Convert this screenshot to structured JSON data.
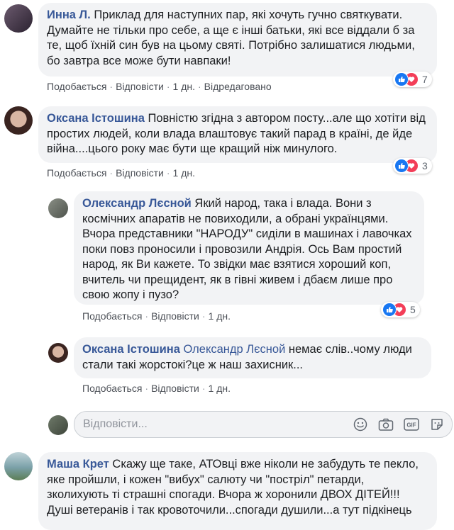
{
  "comments": [
    {
      "author": "Инна Л.",
      "text": "Приклад для наступних пар, які хочуть гучно святкувати. Думайте не тільки про себе, а ще є інші батьки, які все віддали б за те, щоб їхній син був на цьому святі. Потрібно залишатися людьми, бо завтра все може бути навпаки!",
      "like_label": "Подобається",
      "reply_label": "Відповісти",
      "time": "1 дн.",
      "edited": "Відредаговано",
      "reaction_count": "7"
    },
    {
      "author": "Оксана Істошина",
      "text": "Повністю згідна з автором посту...але що хотіти від простих людей, коли влада влаштовує такий парад в країні, де йде війна....цього року має бути ще кращий ніж минулого.",
      "like_label": "Подобається",
      "reply_label": "Відповісти",
      "time": "1 дн.",
      "reaction_count": "3"
    },
    {
      "author": "Олександр Лєсной",
      "text": "Який народ, така і влада. Вони з космічних апаратів не повиходили, а обрані українцями. Вчора представники \"НАРОДУ\" сиділи в машинах і лавочках поки повз проносили і провозили Андрія. Ось Вам простий народ, як Ви кажете. То звідки має взятися хороший коп, вчитель чи прещидент, як в гівні живем і дбаєм лише про свою жопу і пузо?",
      "like_label": "Подобається",
      "reply_label": "Відповісти",
      "time": "1 дн.",
      "reaction_count": "5"
    },
    {
      "author": "Оксана Істошина",
      "mention": "Олександр Лєсной",
      "text": "немає слів..чому люди стали такі жорстокі?це ж наш захисник...",
      "like_label": "Подобається",
      "reply_label": "Відповісти",
      "time": "1 дн."
    },
    {
      "author": "Маша Крет",
      "text": "Скажу ще таке, АТОвці вже ніколи не забудуть те пекло, яке пройшли, і кожен \"вибух\" салюту чи \"постріл\" петарди, зколихують ті страшні спогади. Вчора ж хоронили ДВОХ ДІТЕЙ!!! Душі ветеранів і так кровоточили...спогади душили...а тут підкінець"
    }
  ],
  "reply_box": {
    "placeholder": "Відповісти...",
    "icons": [
      "emoji-icon",
      "camera-icon",
      "gif-icon",
      "sticker-icon"
    ]
  },
  "colors": {
    "author": "#385898",
    "bubble": "#f2f3f5",
    "like": "#1877f2",
    "love": "#f33e58"
  }
}
